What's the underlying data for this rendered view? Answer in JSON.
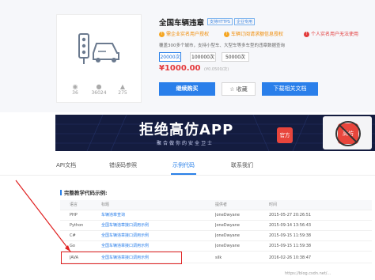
{
  "product": {
    "title": "全国车辆违章",
    "tags": [
      "支持HTTPS",
      "企业专用"
    ],
    "notices": [
      {
        "icon": "!",
        "text": "需企业实名用户授权"
      },
      {
        "icon": "!",
        "text": "车辆订阅请求额信息授权"
      },
      {
        "icon": "!",
        "text": "个人实名用户无法使用"
      }
    ],
    "description": "覆盖300多个城市，支持小型车、大型车等多车型的违章数据查询",
    "quantities": [
      "20000次",
      "100000次",
      "50000次"
    ],
    "selected_quantity": "20000次",
    "price": "¥1000.00",
    "price_original": "(¥0.0500/次)",
    "buy_label": "继续购买",
    "favorite_label": "收藏",
    "download_label": "下载相关文档",
    "stats": [
      {
        "icon": "eye-icon",
        "value": "36"
      },
      {
        "icon": "user-icon",
        "value": "36024"
      },
      {
        "icon": "thumb-icon",
        "value": "275"
      }
    ]
  },
  "banner": {
    "title": "拒绝高仿APP",
    "subtitle": "聚合做你的安全卫士",
    "badge": "官方",
    "badge_alt": "高仿"
  },
  "tabs": [
    {
      "label": "API文档",
      "active": false
    },
    {
      "label": "错误码参照",
      "active": false
    },
    {
      "label": "示例代码",
      "active": true
    },
    {
      "label": "联系我们",
      "active": false
    }
  ],
  "code_section": {
    "title": "完整教学代码示例:",
    "columns": [
      "语言",
      "标题",
      "提供者",
      "时间"
    ],
    "rows": [
      {
        "lang": "PHP",
        "title": "车辆违章查询",
        "author": "JoneDwyane",
        "time": "2015-05-27 20:26:51"
      },
      {
        "lang": "Python",
        "title": "全国车辆违章接口调用示例",
        "author": "JoneDwyane",
        "time": "2015-09-14 13:56:43"
      },
      {
        "lang": "C#",
        "title": "全国车辆违章接口调用示例",
        "author": "JoneDwyane",
        "time": "2015-09-15 11:59:38"
      },
      {
        "lang": "Go",
        "title": "全国车辆违章接口调用示例",
        "author": "JoneDwyane",
        "time": "2015-09-15 11:59:38"
      },
      {
        "lang": "JAVA",
        "title": "全国车辆违章接口调用示例",
        "author": "silk",
        "time": "2016-02-26 10:38:47"
      }
    ]
  },
  "watermark": "https://blog.csdn.net/...",
  "colors": {
    "accent": "#2a7fea",
    "price": "#e4393c",
    "highlight": "#e02020",
    "notice_orange": "#f08a00",
    "notice_red": "#e23b3b"
  }
}
